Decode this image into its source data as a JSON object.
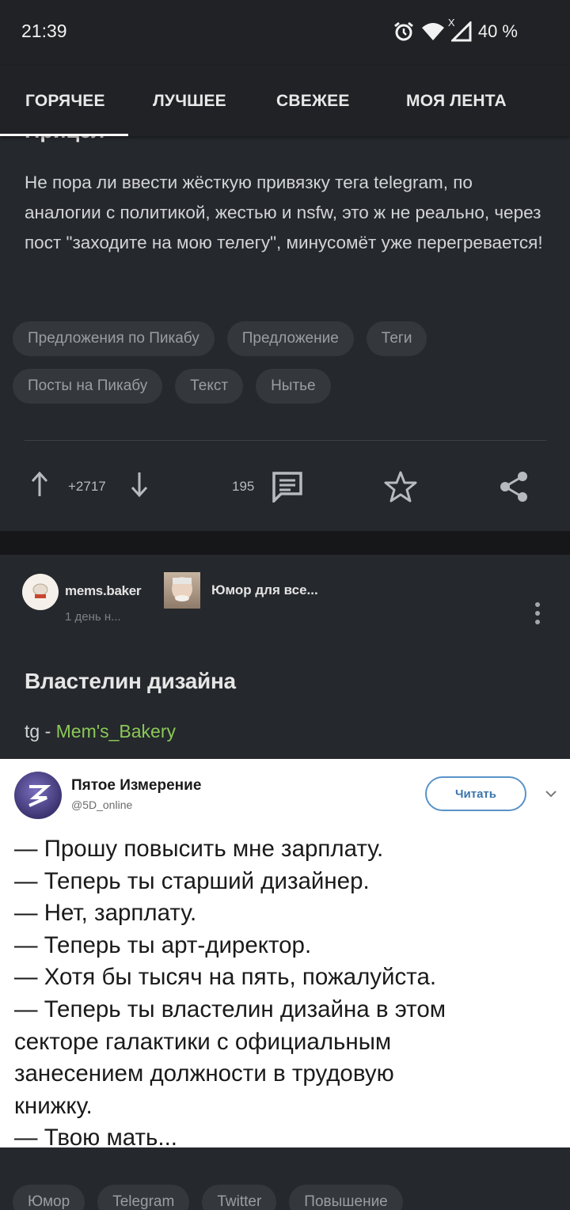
{
  "status": {
    "time": "21:39",
    "battery": "40 %",
    "signal_label": "X"
  },
  "tabs": [
    "ГОРЯЧЕЕ",
    "ЛУЧШЕЕ",
    "СВЕЖЕЕ",
    "МОЯ ЛЕНТА"
  ],
  "post1": {
    "title_peek": "Прицел",
    "text": "Не пора ли ввести жёсткую привязку тега telegram, по аналогии с политикой, жестью и nsfw, это ж не реально, через пост \"заходите на мою телегу\", минусомёт уже перегревается!",
    "tags_row1": [
      "Предложения по Пикабу",
      "Предложение",
      "Теги"
    ],
    "tags_row2": [
      "Посты на Пикабу",
      "Текст",
      "Нытье"
    ],
    "rating": "+2717",
    "comments": "195"
  },
  "post2": {
    "author": "mems.baker",
    "time": "1 день н...",
    "community": "Юмор для все...",
    "title": "Властелин дизайна",
    "desc_prefix": "tg - ",
    "desc_link": "Mem's_Bakery",
    "tweet": {
      "name": "Пятое Измерение",
      "handle": "@5D_online",
      "follow": "Читать",
      "lines": [
        "— Прошу повысить мне зарплату.",
        "— Теперь ты старший дизайнер.",
        "— Нет, зарплату.",
        "— Теперь ты арт-директор.",
        "— Хотя бы тысяч на пять, пожалуйста.",
        "— Теперь ты властелин дизайна в этом",
        "секторе галактики с официальным",
        "занесением должности в трудовую",
        "книжку.",
        "— Твою мать..."
      ]
    },
    "tags": [
      "Юмор",
      "Telegram",
      "Twitter",
      "Повышение"
    ]
  },
  "colors": {
    "background": "#202225",
    "card": "#25282c",
    "link": "#8ac858",
    "tag_bg": "#34383d"
  }
}
